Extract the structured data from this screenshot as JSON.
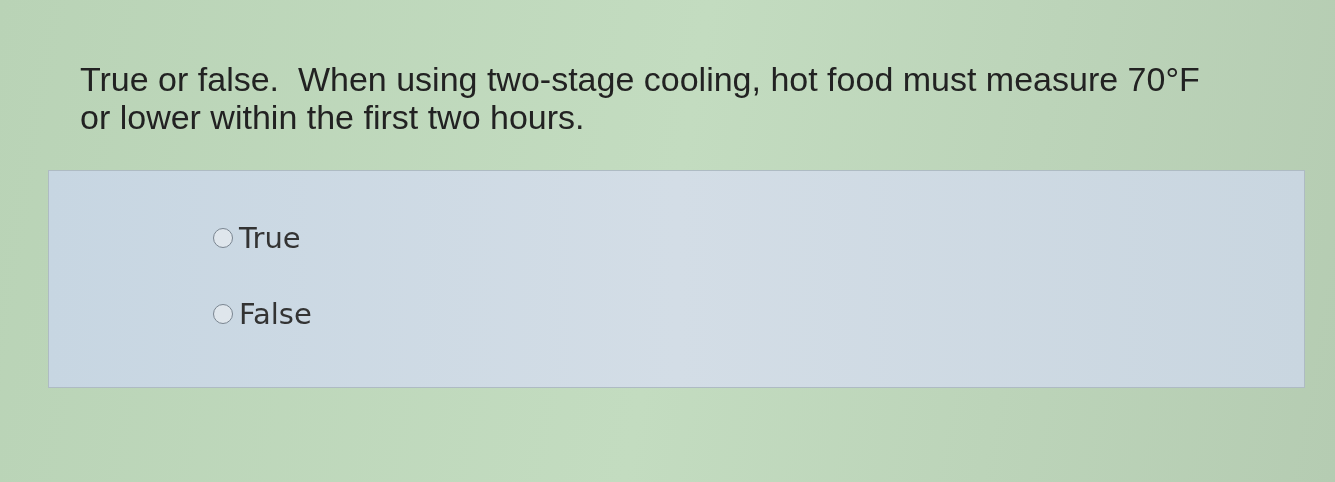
{
  "question": {
    "text": "True or false.  When using two-stage cooling, hot food must measure 70°F or lower within the first two hours."
  },
  "options": [
    {
      "label": "True",
      "selected": false
    },
    {
      "label": "False",
      "selected": false
    }
  ]
}
